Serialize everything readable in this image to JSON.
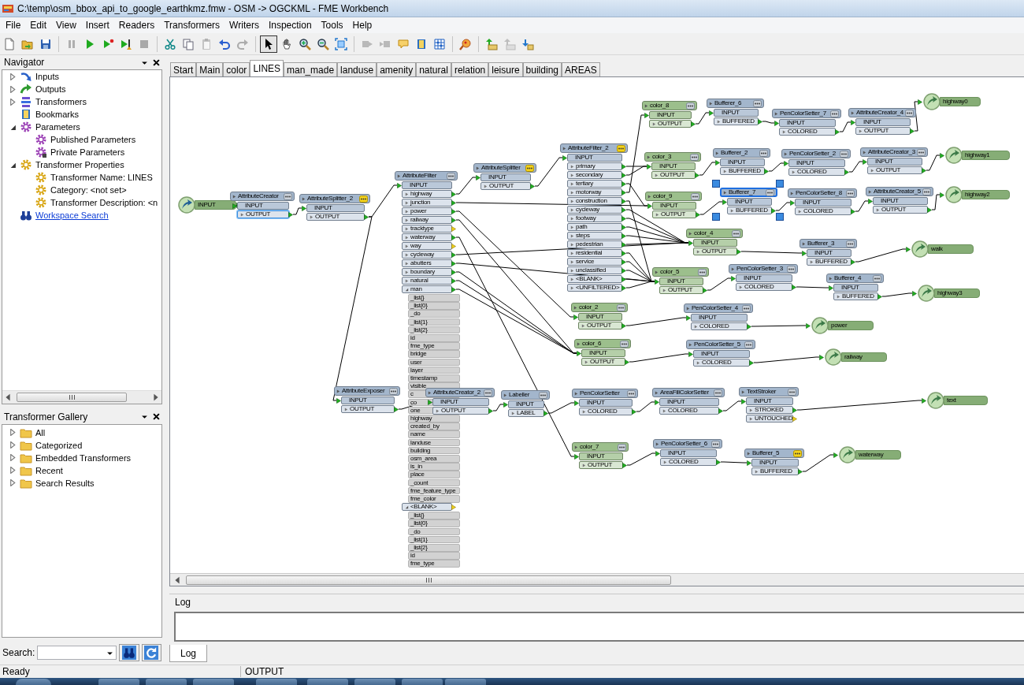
{
  "window": {
    "title": "C:\\temp\\osm_bbox_api_to_google_earthkmz.fmw - OSM -> OGCKML - FME Workbench"
  },
  "menu": [
    "File",
    "Edit",
    "View",
    "Insert",
    "Readers",
    "Transformers",
    "Writers",
    "Inspection",
    "Tools",
    "Help"
  ],
  "toolbar": [
    {
      "disabled": false,
      "pressed": false
    },
    {
      "disabled": false,
      "pressed": false
    },
    {
      "disabled": false,
      "pressed": false
    },
    {
      "disabled": true,
      "pressed": false
    },
    {
      "disabled": false,
      "pressed": false
    },
    {
      "disabled": false,
      "pressed": false
    },
    {
      "disabled": false,
      "pressed": false
    },
    {
      "disabled": true,
      "pressed": false
    },
    {
      "disabled": false,
      "pressed": false
    },
    {
      "disabled": false,
      "pressed": false
    },
    {
      "disabled": true,
      "pressed": false
    },
    {
      "disabled": false,
      "pressed": false
    },
    {
      "disabled": true,
      "pressed": false
    },
    {
      "disabled": false,
      "pressed": true
    },
    {
      "disabled": false,
      "pressed": false
    },
    {
      "disabled": false,
      "pressed": false
    },
    {
      "disabled": false,
      "pressed": false
    },
    {
      "disabled": false,
      "pressed": false
    },
    {
      "disabled": true,
      "pressed": false
    },
    {
      "disabled": true,
      "pressed": false
    },
    {
      "disabled": false,
      "pressed": false
    },
    {
      "disabled": false,
      "pressed": false
    },
    {
      "disabled": false,
      "pressed": false
    },
    {
      "disabled": false,
      "pressed": false
    },
    {
      "disabled": false,
      "pressed": false
    },
    {
      "disabled": true,
      "pressed": false
    },
    {
      "disabled": false,
      "pressed": false
    }
  ],
  "navigator": {
    "title": "Navigator",
    "items": [
      {
        "label": "Inputs",
        "kind": "inputs",
        "expanded": false
      },
      {
        "label": "Outputs",
        "kind": "outputs",
        "expanded": false
      },
      {
        "label": "Transformers",
        "kind": "transformers",
        "expanded": false
      },
      {
        "label": "Bookmarks",
        "kind": "bookmarks"
      },
      {
        "label": "Parameters",
        "kind": "parameter",
        "expanded": true,
        "children": [
          {
            "label": "Published Parameters",
            "kind": "parameter"
          },
          {
            "label": "Private Parameters",
            "kind": "private-parameter"
          }
        ]
      },
      {
        "label": "Transformer Properties",
        "kind": "property",
        "expanded": true,
        "children": [
          {
            "label": "Transformer Name: LINES",
            "kind": "property"
          },
          {
            "label": "Category: <not set>",
            "kind": "property"
          },
          {
            "label": "Transformer Description: <n",
            "kind": "property"
          }
        ]
      },
      {
        "label": "Workspace Search",
        "kind": "search"
      }
    ]
  },
  "gallery": {
    "title": "Transformer Gallery",
    "items": [
      {
        "label": "All",
        "expanded": false
      },
      {
        "label": "Categorized",
        "expanded": false
      },
      {
        "label": "Embedded Transformers",
        "expanded": false
      },
      {
        "label": "Recent",
        "expanded": false
      },
      {
        "label": "Search Results",
        "expanded": false
      }
    ],
    "search_label": "Search:"
  },
  "tabs": [
    {
      "label": "Start",
      "selected": false
    },
    {
      "label": "Main",
      "selected": false
    },
    {
      "label": "color",
      "selected": false
    },
    {
      "label": "LINES",
      "selected": true
    },
    {
      "label": "man_made",
      "selected": false
    },
    {
      "label": "landuse",
      "selected": false
    },
    {
      "label": "amenity",
      "selected": false
    },
    {
      "label": "natural",
      "selected": false
    },
    {
      "label": "relation",
      "selected": false
    },
    {
      "label": "leisure",
      "selected": false
    },
    {
      "label": "building",
      "selected": false
    },
    {
      "label": "AREAS",
      "selected": false
    }
  ],
  "canvas": {
    "nodes": [
      {
        "kind": "reader",
        "name": "INPUT"
      },
      {
        "kind": "transformer",
        "name": "AttributeCreator",
        "color": "#a3b6cc",
        "flagged": false,
        "selected": false,
        "inputs": [
          "INPUT"
        ],
        "outputs": [
          {
            "label": "OUTPUT",
            "connected": true,
            "expanded": false,
            "selected": true
          }
        ]
      },
      {
        "kind": "transformer",
        "name": "AttributeSplitter_2",
        "color": "#a3b6cc",
        "flagged": true,
        "selected": false,
        "inputs": [
          "INPUT"
        ],
        "outputs": [
          {
            "label": "OUTPUT",
            "connected": true,
            "expanded": false,
            "selected": false
          }
        ]
      },
      {
        "kind": "transformer",
        "name": "AttributeFilter",
        "color": "#a3b6cc",
        "flagged": false,
        "selected": false,
        "inputs": [
          "INPUT"
        ],
        "outputs": [
          {
            "label": "highway",
            "connected": true,
            "expanded": false,
            "selected": false
          },
          {
            "label": "junction",
            "connected": true,
            "expanded": false,
            "selected": false
          },
          {
            "label": "power",
            "connected": true,
            "expanded": false,
            "selected": false
          },
          {
            "label": "railway",
            "connected": true,
            "expanded": false,
            "selected": false
          },
          {
            "label": "tracktype",
            "connected": false,
            "expanded": false,
            "selected": false
          },
          {
            "label": "waterway",
            "connected": true,
            "expanded": false,
            "selected": false
          },
          {
            "label": "way",
            "connected": false,
            "expanded": false,
            "selected": false
          },
          {
            "label": "cycleway",
            "connected": true,
            "expanded": false,
            "selected": false
          },
          {
            "label": "abutters",
            "connected": true,
            "expanded": false,
            "selected": false
          },
          {
            "label": "boundary",
            "connected": true,
            "expanded": false,
            "selected": false
          },
          {
            "label": "natural",
            "connected": true,
            "expanded": false,
            "selected": false
          },
          {
            "label": "man",
            "connected": true,
            "expanded": true,
            "selected": false,
            "children": [
              "_list{}",
              "_list{0}",
              "_do",
              "_list{1}",
              "_list{2}",
              "id",
              "fme_type",
              "bridge",
              "user",
              "layer",
              "timestamp",
              "visible",
              "c",
              "co",
              "one",
              "highway",
              "created_by",
              "name",
              "landuse",
              "building",
              "osm_area",
              "is_in",
              "place",
              "_count",
              "fme_feature_type",
              "fme_color"
            ]
          },
          {
            "label": "<BLANK>",
            "connected": false,
            "expanded": true,
            "selected": false,
            "children": [
              "_list{}",
              "_list{0}",
              "_do",
              "_list{1}",
              "_list{2}",
              "id",
              "fme_type"
            ]
          }
        ]
      },
      {
        "kind": "transformer",
        "name": "AttributeSplitter",
        "color": "#a3b6cc",
        "flagged": true,
        "selected": false,
        "inputs": [
          "INPUT"
        ],
        "outputs": [
          {
            "label": "OUTPUT",
            "connected": true,
            "expanded": false,
            "selected": false
          }
        ]
      },
      {
        "kind": "transformer",
        "name": "AttributeFilter_2",
        "color": "#a3b6cc",
        "flagged": true,
        "selected": false,
        "inputs": [
          "INPUT"
        ],
        "outputs": [
          {
            "label": "primary",
            "connected": true,
            "expanded": false,
            "selected": false
          },
          {
            "label": "secondary",
            "connected": true,
            "expanded": false,
            "selected": false
          },
          {
            "label": "tertiary",
            "connected": true,
            "expanded": false,
            "selected": false
          },
          {
            "label": "motorway",
            "connected": true,
            "expanded": false,
            "selected": false
          },
          {
            "label": "construction",
            "connected": true,
            "expanded": false,
            "selected": false
          },
          {
            "label": "cycleway",
            "connected": true,
            "expanded": false,
            "selected": false
          },
          {
            "label": "footway",
            "connected": true,
            "expanded": false,
            "selected": false
          },
          {
            "label": "path",
            "connected": true,
            "expanded": false,
            "selected": false
          },
          {
            "label": "steps",
            "connected": true,
            "expanded": false,
            "selected": false
          },
          {
            "label": "pedestrian",
            "connected": true,
            "expanded": false,
            "selected": false
          },
          {
            "label": "residential",
            "connected": true,
            "expanded": false,
            "selected": false
          },
          {
            "label": "service",
            "connected": true,
            "expanded": false,
            "selected": false
          },
          {
            "label": "unclassified",
            "connected": true,
            "expanded": false,
            "selected": false
          },
          {
            "label": "<BLANK>",
            "connected": true,
            "expanded": false,
            "selected": false
          },
          {
            "label": "<UNFILTERED>",
            "connected": true,
            "expanded": false,
            "selected": false
          }
        ]
      },
      {
        "kind": "transformer",
        "name": "color_8",
        "color": "#9cbf8c",
        "flagged": false,
        "selected": false,
        "inputs": [
          "INPUT"
        ],
        "outputs": [
          {
            "label": "OUTPUT",
            "connected": true,
            "expanded": false,
            "selected": false
          }
        ]
      },
      {
        "kind": "transformer",
        "name": "Bufferer_6",
        "color": "#a3b6cc",
        "flagged": false,
        "selected": false,
        "inputs": [
          "INPUT"
        ],
        "outputs": [
          {
            "label": "BUFFERED",
            "connected": true,
            "expanded": false,
            "selected": false
          }
        ]
      },
      {
        "kind": "transformer",
        "name": "PenColorSetter_7",
        "color": "#a3b6cc",
        "flagged": false,
        "selected": false,
        "inputs": [
          "INPUT"
        ],
        "outputs": [
          {
            "label": "COLORED",
            "connected": true,
            "expanded": false,
            "selected": false
          }
        ]
      },
      {
        "kind": "transformer",
        "name": "AttributeCreator_4",
        "color": "#a3b6cc",
        "flagged": false,
        "selected": false,
        "inputs": [
          "INPUT"
        ],
        "outputs": [
          {
            "label": "OUTPUT",
            "connected": true,
            "expanded": false,
            "selected": false
          }
        ]
      },
      {
        "kind": "writer",
        "name": "highway0"
      },
      {
        "kind": "transformer",
        "name": "color_3",
        "color": "#9cbf8c",
        "flagged": false,
        "selected": false,
        "inputs": [
          "INPUT"
        ],
        "outputs": [
          {
            "label": "OUTPUT",
            "connected": true,
            "expanded": false,
            "selected": false
          }
        ]
      },
      {
        "kind": "transformer",
        "name": "Bufferer_2",
        "color": "#a3b6cc",
        "flagged": false,
        "selected": false,
        "inputs": [
          "INPUT"
        ],
        "outputs": [
          {
            "label": "BUFFERED",
            "connected": true,
            "expanded": false,
            "selected": false
          }
        ]
      },
      {
        "kind": "transformer",
        "name": "PenColorSetter_2",
        "color": "#a3b6cc",
        "flagged": false,
        "selected": false,
        "inputs": [
          "INPUT"
        ],
        "outputs": [
          {
            "label": "COLORED",
            "connected": true,
            "expanded": false,
            "selected": false
          }
        ]
      },
      {
        "kind": "transformer",
        "name": "AttributeCreator_3",
        "color": "#a3b6cc",
        "flagged": false,
        "selected": false,
        "inputs": [
          "INPUT"
        ],
        "outputs": [
          {
            "label": "OUTPUT",
            "connected": true,
            "expanded": false,
            "selected": false
          }
        ]
      },
      {
        "kind": "writer",
        "name": "highway1"
      },
      {
        "kind": "transformer",
        "name": "color_9",
        "color": "#9cbf8c",
        "flagged": false,
        "selected": false,
        "inputs": [
          "INPUT"
        ],
        "outputs": [
          {
            "label": "OUTPUT",
            "connected": true,
            "expanded": false,
            "selected": false
          }
        ]
      },
      {
        "kind": "transformer",
        "name": "Bufferer_7",
        "color": "#a3b6cc",
        "flagged": false,
        "selected": true,
        "inputs": [
          "INPUT"
        ],
        "outputs": [
          {
            "label": "BUFFERED",
            "connected": true,
            "expanded": false,
            "selected": false
          }
        ]
      },
      {
        "kind": "transformer",
        "name": "PenColorSetter_8",
        "color": "#a3b6cc",
        "flagged": false,
        "selected": false,
        "inputs": [
          "INPUT"
        ],
        "outputs": [
          {
            "label": "COLORED",
            "connected": true,
            "expanded": false,
            "selected": false
          }
        ]
      },
      {
        "kind": "transformer",
        "name": "AttributeCreator_5",
        "color": "#a3b6cc",
        "flagged": false,
        "selected": false,
        "inputs": [
          "INPUT"
        ],
        "outputs": [
          {
            "label": "OUTPUT",
            "connected": true,
            "expanded": false,
            "selected": false
          }
        ]
      },
      {
        "kind": "writer",
        "name": "highway2"
      },
      {
        "kind": "transformer",
        "name": "color_4",
        "color": "#9cbf8c",
        "flagged": false,
        "selected": false,
        "inputs": [
          "INPUT"
        ],
        "outputs": [
          {
            "label": "OUTPUT",
            "connected": true,
            "expanded": false,
            "selected": false
          }
        ]
      },
      {
        "kind": "transformer",
        "name": "Bufferer_3",
        "color": "#a3b6cc",
        "flagged": false,
        "selected": false,
        "inputs": [
          "INPUT"
        ],
        "outputs": [
          {
            "label": "BUFFERED",
            "connected": true,
            "expanded": false,
            "selected": false
          }
        ]
      },
      {
        "kind": "writer",
        "name": "walk"
      },
      {
        "kind": "transformer",
        "name": "color_5",
        "color": "#9cbf8c",
        "flagged": false,
        "selected": false,
        "inputs": [
          "INPUT"
        ],
        "outputs": [
          {
            "label": "OUTPUT",
            "connected": true,
            "expanded": false,
            "selected": false
          }
        ]
      },
      {
        "kind": "transformer",
        "name": "PenColorSetter_3",
        "color": "#a3b6cc",
        "flagged": false,
        "selected": false,
        "inputs": [
          "INPUT"
        ],
        "outputs": [
          {
            "label": "COLORED",
            "connected": true,
            "expanded": false,
            "selected": false
          }
        ]
      },
      {
        "kind": "transformer",
        "name": "Bufferer_4",
        "color": "#a3b6cc",
        "flagged": false,
        "selected": false,
        "inputs": [
          "INPUT"
        ],
        "outputs": [
          {
            "label": "BUFFERED",
            "connected": true,
            "expanded": false,
            "selected": false
          }
        ]
      },
      {
        "kind": "writer",
        "name": "highway3"
      },
      {
        "kind": "transformer",
        "name": "color_2",
        "color": "#9cbf8c",
        "flagged": false,
        "selected": false,
        "inputs": [
          "INPUT"
        ],
        "outputs": [
          {
            "label": "OUTPUT",
            "connected": true,
            "expanded": false,
            "selected": false
          }
        ]
      },
      {
        "kind": "transformer",
        "name": "PenColorSetter_4",
        "color": "#a3b6cc",
        "flagged": false,
        "selected": false,
        "inputs": [
          "INPUT"
        ],
        "outputs": [
          {
            "label": "COLORED",
            "connected": true,
            "expanded": false,
            "selected": false
          }
        ]
      },
      {
        "kind": "writer",
        "name": "power"
      },
      {
        "kind": "transformer",
        "name": "color_6",
        "color": "#9cbf8c",
        "flagged": false,
        "selected": false,
        "inputs": [
          "INPUT"
        ],
        "outputs": [
          {
            "label": "OUTPUT",
            "connected": true,
            "expanded": false,
            "selected": false
          }
        ]
      },
      {
        "kind": "transformer",
        "name": "PenColorSetter_5",
        "color": "#a3b6cc",
        "flagged": false,
        "selected": false,
        "inputs": [
          "INPUT"
        ],
        "outputs": [
          {
            "label": "COLORED",
            "connected": true,
            "expanded": false,
            "selected": false
          }
        ]
      },
      {
        "kind": "writer",
        "name": "railway"
      },
      {
        "kind": "transformer",
        "name": "AttributeExposer",
        "color": "#a3b6cc",
        "flagged": false,
        "selected": false,
        "inputs": [
          "INPUT"
        ],
        "outputs": [
          {
            "label": "OUTPUT",
            "connected": true,
            "expanded": false,
            "selected": false
          }
        ]
      },
      {
        "kind": "transformer",
        "name": "AttributeCreator_2",
        "color": "#a3b6cc",
        "flagged": false,
        "selected": false,
        "inputs": [
          "INPUT"
        ],
        "outputs": [
          {
            "label": "OUTPUT",
            "connected": true,
            "expanded": false,
            "selected": false
          }
        ]
      },
      {
        "kind": "transformer",
        "name": "Labeller",
        "color": "#a3b6cc",
        "flagged": false,
        "selected": false,
        "inputs": [
          "INPUT"
        ],
        "outputs": [
          {
            "label": "LABEL",
            "connected": true,
            "expanded": false,
            "selected": false
          }
        ]
      },
      {
        "kind": "transformer",
        "name": "PenColorSetter",
        "color": "#a3b6cc",
        "flagged": false,
        "selected": false,
        "inputs": [
          "INPUT"
        ],
        "outputs": [
          {
            "label": "COLORED",
            "connected": true,
            "expanded": false,
            "selected": false
          }
        ]
      },
      {
        "kind": "transformer",
        "name": "AreaFillColorSetter",
        "color": "#a3b6cc",
        "flagged": false,
        "selected": false,
        "inputs": [
          "INPUT"
        ],
        "outputs": [
          {
            "label": "COLORED",
            "connected": true,
            "expanded": false,
            "selected": false
          }
        ]
      },
      {
        "kind": "transformer",
        "name": "TextStroker",
        "color": "#a3b6cc",
        "flagged": false,
        "selected": false,
        "inputs": [
          "INPUT"
        ],
        "outputs": [
          {
            "label": "STROKED",
            "connected": true,
            "expanded": false,
            "selected": false
          },
          {
            "label": "UNTOUCHED",
            "connected": false,
            "expanded": false,
            "selected": false
          }
        ]
      },
      {
        "kind": "writer",
        "name": "text"
      },
      {
        "kind": "transformer",
        "name": "color_7",
        "color": "#9cbf8c",
        "flagged": false,
        "selected": false,
        "inputs": [
          "INPUT"
        ],
        "outputs": [
          {
            "label": "OUTPUT",
            "connected": true,
            "expanded": false,
            "selected": false
          }
        ]
      },
      {
        "kind": "transformer",
        "name": "PenColorSetter_6",
        "color": "#a3b6cc",
        "flagged": false,
        "selected": false,
        "inputs": [
          "INPUT"
        ],
        "outputs": [
          {
            "label": "COLORED",
            "connected": true,
            "expanded": false,
            "selected": false
          }
        ]
      },
      {
        "kind": "transformer",
        "name": "Bufferer_5",
        "color": "#a3b6cc",
        "flagged": true,
        "selected": false,
        "inputs": [
          "INPUT"
        ],
        "outputs": [
          {
            "label": "BUFFERED",
            "connected": true,
            "expanded": false,
            "selected": false
          }
        ]
      },
      {
        "kind": "writer",
        "name": "waterway"
      }
    ]
  },
  "log": {
    "title": "Log",
    "tabs": [
      {
        "label": "Log",
        "selected": true
      }
    ]
  },
  "status_bar": [
    "Ready",
    "OUTPUT"
  ]
}
